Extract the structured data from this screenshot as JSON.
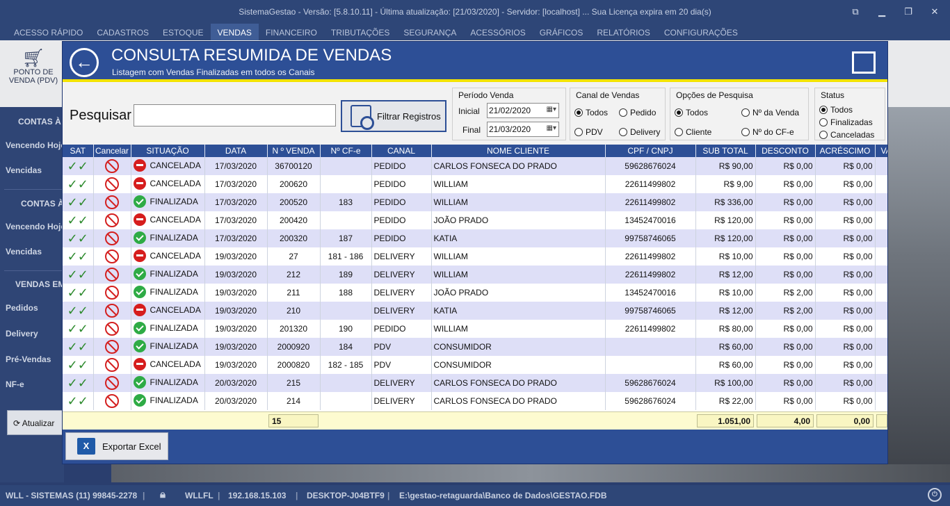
{
  "window": {
    "title": "SistemaGestao - Versão: [5.8.10.11] - Última atualização: [21/03/2020] - Servidor: [localhost] ... Sua Licença expira em 20 dia(s)"
  },
  "menu": [
    "ACESSO RÁPIDO",
    "CADASTROS",
    "ESTOQUE",
    "VENDAS",
    "FINANCEIRO",
    "TRIBUTAÇÕES",
    "SEGURANÇA",
    "ACESSÓRIOS",
    "GRÁFICOS",
    "RELATÓRIOS",
    "CONFIGURAÇÕES"
  ],
  "ribbon": {
    "pdv_line1": "PONTO DE",
    "pdv_line2": "VENDA (PDV)"
  },
  "sidebar": {
    "h1": "CONTAS À R",
    "i1": "Vencendo Hoje",
    "i2": "Vencidas",
    "h2": "CONTAS À",
    "i3": "Vencendo Hoje",
    "i4": "Vencidas",
    "h3": "VENDAS EM",
    "i5": "Pedidos",
    "i6": "Delivery",
    "i7": "Pré-Vendas",
    "i8": "NF-e",
    "atualizar": "Atualizar"
  },
  "status": {
    "company": "WLL - SISTEMAS (11) 99845-2278",
    "user": "WLLFL",
    "ip": "192.168.15.103",
    "host": "DESKTOP-J04BTF9",
    "db": "E:\\gestao-retaguarda\\Banco de Dados\\GESTAO.FDB"
  },
  "modal": {
    "title": "CONSULTA RESUMIDA DE VENDAS",
    "subtitle": "Listagem com Vendas Finalizadas em todos os Canais",
    "search_label": "Pesquisar",
    "search_value": "",
    "filter_button": "Filtrar Registros",
    "periodo": {
      "legend": "Período Venda",
      "inicial_label": "Inicial",
      "inicial": "21/02/2020",
      "final_label": "Final",
      "final": "21/03/2020"
    },
    "canal": {
      "legend": "Canal de Vendas",
      "todos": "Todos",
      "pedido": "Pedido",
      "pdv": "PDV",
      "delivery": "Delivery",
      "selected": "Todos"
    },
    "opcoes": {
      "legend": "Opções de Pesquisa",
      "todos": "Todos",
      "venda": "Nº da Venda",
      "cliente": "Cliente",
      "cfe": "Nº do CF-e",
      "selected": "Todos"
    },
    "status": {
      "legend": "Status",
      "todos": "Todos",
      "finalizadas": "Finalizadas",
      "canceladas": "Canceladas",
      "selected": "Todos"
    },
    "export_button": "Exportar Excel"
  },
  "grid": {
    "columns": [
      "SAT",
      "Cancelar",
      "SITUAÇÃO",
      "DATA",
      "N º VENDA",
      "Nº CF-e",
      "CANAL",
      "NOME CLIENTE",
      "CPF / CNPJ",
      "SUB TOTAL",
      "DESCONTO",
      "ACRÉSCIMO",
      "VA"
    ],
    "rows": [
      {
        "situacao": "CANCELADA",
        "status": "cancel",
        "data": "17/03/2020",
        "venda": "36700120",
        "cfe": "",
        "canal": "PEDIDO",
        "cliente": "CARLOS FONSECA DO PRADO",
        "cpf": "59628676024",
        "subtotal": "R$ 90,00",
        "desconto": "R$ 0,00",
        "acrescimo": "R$ 0,00"
      },
      {
        "situacao": "CANCELADA",
        "status": "cancel",
        "data": "17/03/2020",
        "venda": "200620",
        "cfe": "",
        "canal": "PEDIDO",
        "cliente": "WILLIAM",
        "cpf": "22611499802",
        "subtotal": "R$ 9,00",
        "desconto": "R$ 0,00",
        "acrescimo": "R$ 0,00"
      },
      {
        "situacao": "FINALIZADA",
        "status": "ok",
        "data": "17/03/2020",
        "venda": "200520",
        "cfe": "183",
        "canal": "PEDIDO",
        "cliente": "WILLIAM",
        "cpf": "22611499802",
        "subtotal": "R$ 336,00",
        "desconto": "R$ 0,00",
        "acrescimo": "R$ 0,00"
      },
      {
        "situacao": "CANCELADA",
        "status": "cancel",
        "data": "17/03/2020",
        "venda": "200420",
        "cfe": "",
        "canal": "PEDIDO",
        "cliente": "JOÃO PRADO",
        "cpf": "13452470016",
        "subtotal": "R$ 120,00",
        "desconto": "R$ 0,00",
        "acrescimo": "R$ 0,00"
      },
      {
        "situacao": "FINALIZADA",
        "status": "ok",
        "data": "17/03/2020",
        "venda": "200320",
        "cfe": "187",
        "canal": "PEDIDO",
        "cliente": "KATIA",
        "cpf": "99758746065",
        "subtotal": "R$ 120,00",
        "desconto": "R$ 0,00",
        "acrescimo": "R$ 0,00"
      },
      {
        "situacao": "CANCELADA",
        "status": "cancel",
        "data": "19/03/2020",
        "venda": "27",
        "cfe": "181 - 186",
        "canal": "DELIVERY",
        "cliente": "WILLIAM",
        "cpf": "22611499802",
        "subtotal": "R$ 10,00",
        "desconto": "R$ 0,00",
        "acrescimo": "R$ 0,00"
      },
      {
        "situacao": "FINALIZADA",
        "status": "ok",
        "data": "19/03/2020",
        "venda": "212",
        "cfe": "189",
        "canal": "DELIVERY",
        "cliente": "WILLIAM",
        "cpf": "22611499802",
        "subtotal": "R$ 12,00",
        "desconto": "R$ 0,00",
        "acrescimo": "R$ 0,00"
      },
      {
        "situacao": "FINALIZADA",
        "status": "ok",
        "data": "19/03/2020",
        "venda": "211",
        "cfe": "188",
        "canal": "DELIVERY",
        "cliente": "JOÃO PRADO",
        "cpf": "13452470016",
        "subtotal": "R$ 10,00",
        "desconto": "R$ 2,00",
        "acrescimo": "R$ 0,00"
      },
      {
        "situacao": "CANCELADA",
        "status": "cancel",
        "data": "19/03/2020",
        "venda": "210",
        "cfe": "",
        "canal": "DELIVERY",
        "cliente": "KATIA",
        "cpf": "99758746065",
        "subtotal": "R$ 12,00",
        "desconto": "R$ 2,00",
        "acrescimo": "R$ 0,00"
      },
      {
        "situacao": "FINALIZADA",
        "status": "ok",
        "data": "19/03/2020",
        "venda": "201320",
        "cfe": "190",
        "canal": "PEDIDO",
        "cliente": "WILLIAM",
        "cpf": "22611499802",
        "subtotal": "R$ 80,00",
        "desconto": "R$ 0,00",
        "acrescimo": "R$ 0,00"
      },
      {
        "situacao": "FINALIZADA",
        "status": "ok",
        "data": "19/03/2020",
        "venda": "2000920",
        "cfe": "184",
        "canal": "PDV",
        "cliente": "CONSUMIDOR",
        "cpf": "",
        "subtotal": "R$ 60,00",
        "desconto": "R$ 0,00",
        "acrescimo": "R$ 0,00"
      },
      {
        "situacao": "CANCELADA",
        "status": "cancel",
        "data": "19/03/2020",
        "venda": "2000820",
        "cfe": "182 - 185",
        "canal": "PDV",
        "cliente": "CONSUMIDOR",
        "cpf": "",
        "subtotal": "R$ 60,00",
        "desconto": "R$ 0,00",
        "acrescimo": "R$ 0,00"
      },
      {
        "situacao": "FINALIZADA",
        "status": "ok",
        "data": "20/03/2020",
        "venda": "215",
        "cfe": "",
        "canal": "DELIVERY",
        "cliente": "CARLOS FONSECA DO PRADO",
        "cpf": "59628676024",
        "subtotal": "R$ 100,00",
        "desconto": "R$ 0,00",
        "acrescimo": "R$ 0,00"
      },
      {
        "situacao": "FINALIZADA",
        "status": "ok",
        "data": "20/03/2020",
        "venda": "214",
        "cfe": "",
        "canal": "DELIVERY",
        "cliente": "CARLOS FONSECA DO PRADO",
        "cpf": "59628676024",
        "subtotal": "R$ 22,00",
        "desconto": "R$ 0,00",
        "acrescimo": "R$ 0,00"
      }
    ],
    "totals": {
      "count": "15",
      "subtotal": "1.051,00",
      "desconto": "4,00",
      "acrescimo": "0,00"
    }
  },
  "icons": {
    "sat": "double-check-icon",
    "cancel": "ban-icon",
    "ok": "green-check-icon",
    "cancelado": "red-minus-icon"
  },
  "colors": {
    "header_blue": "#2d4f96",
    "accent_yellow": "#f3e300",
    "row_alt": "#dedff7",
    "cancel_red": "#d61d1d",
    "ok_green": "#2eab45"
  }
}
